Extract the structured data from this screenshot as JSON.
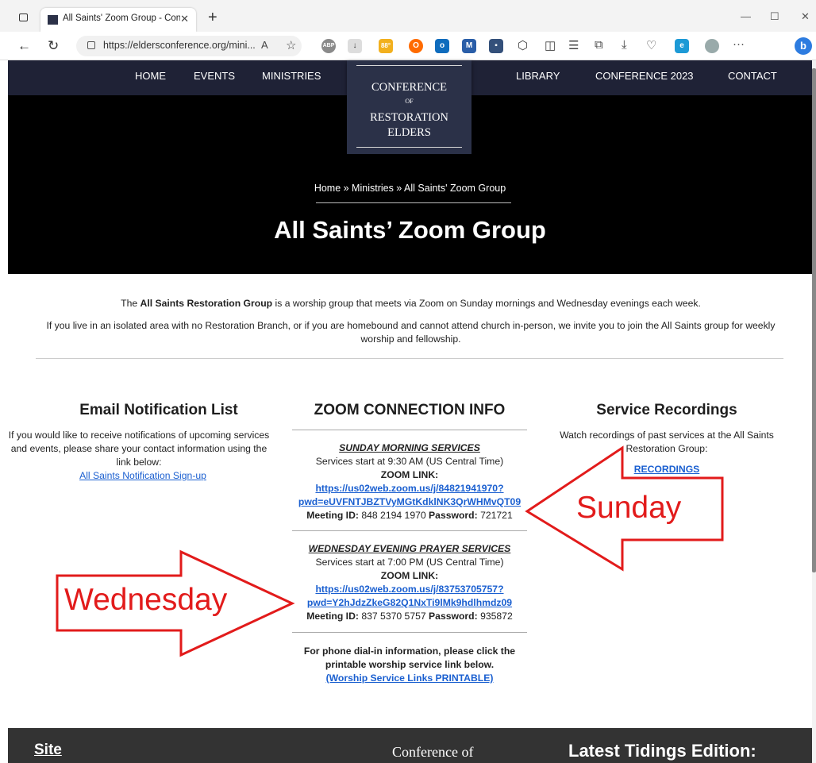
{
  "browser": {
    "tab_title": "All Saints' Zoom Group - Confer",
    "tab_close": "✕",
    "new_tab": "+",
    "url": "https://eldersconference.org/mini...",
    "window": {
      "minimize": "—",
      "maximize": "☐",
      "close": "✕"
    },
    "ext_labels": {
      "abp": "ABP",
      "weather": "88°"
    },
    "menu": "···"
  },
  "nav": {
    "items": [
      "HOME",
      "EVENTS",
      "MINISTRIES",
      "LIBRARY",
      "CONFERENCE 2023",
      "CONTACT"
    ]
  },
  "logo": {
    "line1": "CONFERENCE",
    "line2": "OF",
    "line3": "RESTORATION",
    "line4": "ELDERS"
  },
  "hero": {
    "breadcrumb": "Home » Ministries » All Saints' Zoom Group",
    "title": "All Saints’ Zoom Group"
  },
  "intro": {
    "p1_pre": "The ",
    "p1_bold": "All Saints Restoration Group",
    "p1_post": " is a worship group that meets via Zoom on Sunday mornings and Wednesday evenings each week.",
    "p2": "If you live in an isolated area with no Restoration Branch, or if you are homebound and cannot attend church in-person, we invite you to join the All Saints group for weekly worship and fellowship."
  },
  "email": {
    "heading": "Email Notification List",
    "text": "If you would like to receive notifications of upcoming services and events, please share your contact information using the link below:",
    "link": "All Saints Notification Sign-up"
  },
  "zoom": {
    "heading": "ZOOM CONNECTION INFO",
    "sunday": {
      "title": "SUNDAY MORNING SERVICES",
      "start": "Services start at 9:30 AM (US Central Time)",
      "zoom_label": "ZOOM LINK:",
      "link_1": "https://us02web.zoom.us/j/84821941970?",
      "link_2": "pwd=eUVFNTJBZTVyMGtKdklNK3QrWHMvQT09",
      "meeting_label": "Meeting ID:",
      "meeting_id": " 848 2194 1970 ",
      "password_label": "Password:",
      "password": " 721721"
    },
    "wednesday": {
      "title": "WEDNESDAY EVENING PRAYER SERVICES",
      "start": "Services start at 7:00 PM (US Central Time)",
      "zoom_label": "ZOOM LINK:",
      "link_1": "https://us02web.zoom.us/j/83753705757?",
      "link_2": "pwd=Y2hJdzZkeG82Q1NxTi9lMk9hdlhmdz09",
      "meeting_label": "Meeting ID:",
      "meeting_id": " 837 5370 5757 ",
      "password_label": "Password:",
      "password": " 935872"
    },
    "phone_text": "For phone dial-in information, please click the printable worship service link below.",
    "phone_link": "(Worship Service Links PRINTABLE)"
  },
  "recordings": {
    "heading": "Service Recordings",
    "text": "Watch recordings of past services at the All Saints Restoration Group:",
    "link": "RECORDINGS"
  },
  "annotations": {
    "sunday": "Sunday",
    "wednesday": "Wednesday",
    "color": "#e21b1b"
  },
  "footer": {
    "site": "Site",
    "conference": "Conference of",
    "tidings": "Latest Tidings Edition:"
  }
}
